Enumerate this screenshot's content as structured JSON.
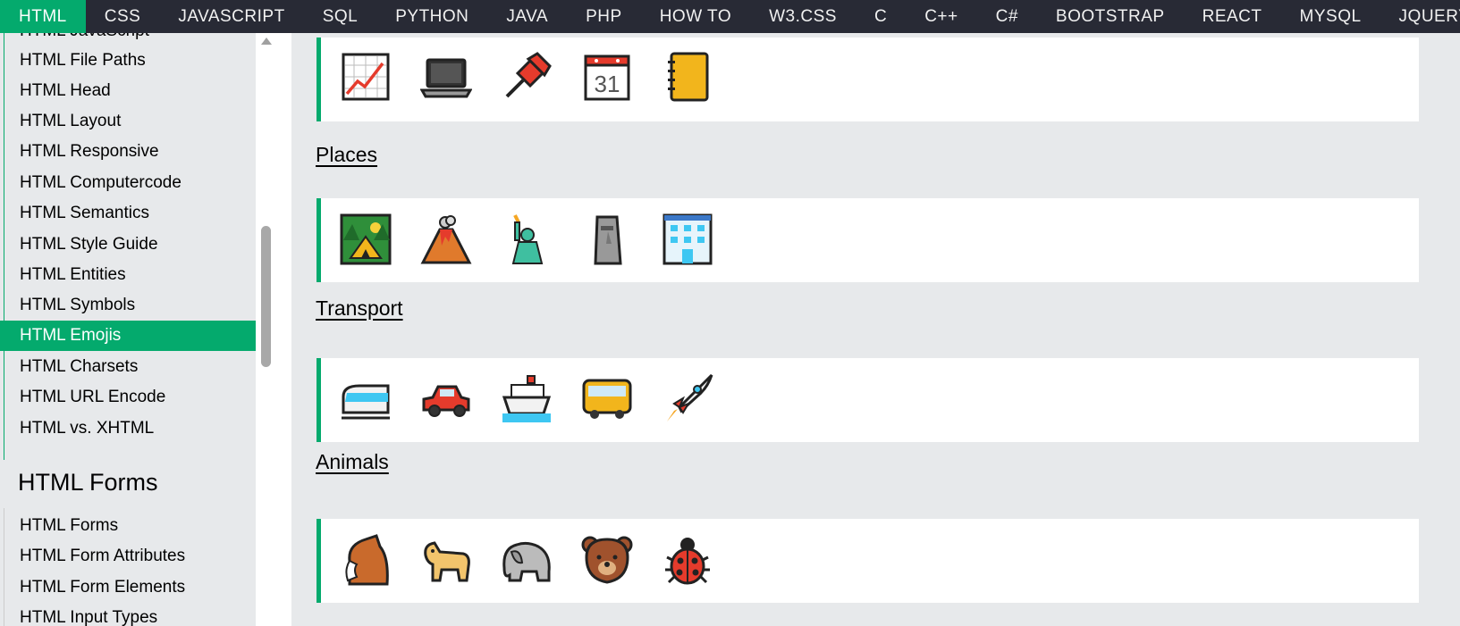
{
  "topnav": {
    "items": [
      "HTML",
      "CSS",
      "JAVASCRIPT",
      "SQL",
      "PYTHON",
      "JAVA",
      "PHP",
      "HOW TO",
      "W3.CSS",
      "C",
      "C++",
      "C#",
      "BOOTSTRAP",
      "REACT",
      "MYSQL",
      "JQUERY"
    ],
    "active": "HTML"
  },
  "sidebar": {
    "partial_top": "HTML JavaScript",
    "items": [
      "HTML File Paths",
      "HTML Head",
      "HTML Layout",
      "HTML Responsive",
      "HTML Computercode",
      "HTML Semantics",
      "HTML Style Guide",
      "HTML Entities",
      "HTML Symbols",
      "HTML Emojis",
      "HTML Charsets",
      "HTML URL Encode",
      "HTML vs. XHTML"
    ],
    "active": "HTML Emojis",
    "forms_heading": "HTML Forms",
    "forms_items": [
      "HTML Forms",
      "HTML Form Attributes",
      "HTML Form Elements",
      "HTML Input Types"
    ]
  },
  "sections": {
    "objects": {
      "emojis": [
        "chart-increasing-icon",
        "laptop-icon",
        "pushpin-icon",
        "calendar-icon",
        "notebook-icon"
      ],
      "calendar_day": "31"
    },
    "places": {
      "title": "Places",
      "emojis": [
        "camping-icon",
        "volcano-icon",
        "statue-of-liberty-icon",
        "moai-icon",
        "office-building-icon"
      ]
    },
    "transport": {
      "title": "Transport",
      "emojis": [
        "train-icon",
        "car-icon",
        "ship-icon",
        "bus-icon",
        "rocket-icon"
      ]
    },
    "animals": {
      "title": "Animals",
      "emojis": [
        "horse-icon",
        "dog-icon",
        "elephant-icon",
        "bear-icon",
        "ladybug-icon"
      ]
    }
  },
  "colors": {
    "accent": "#04aa6d",
    "topnav_bg": "#282a35",
    "panel_bg": "#e7e9eb"
  }
}
